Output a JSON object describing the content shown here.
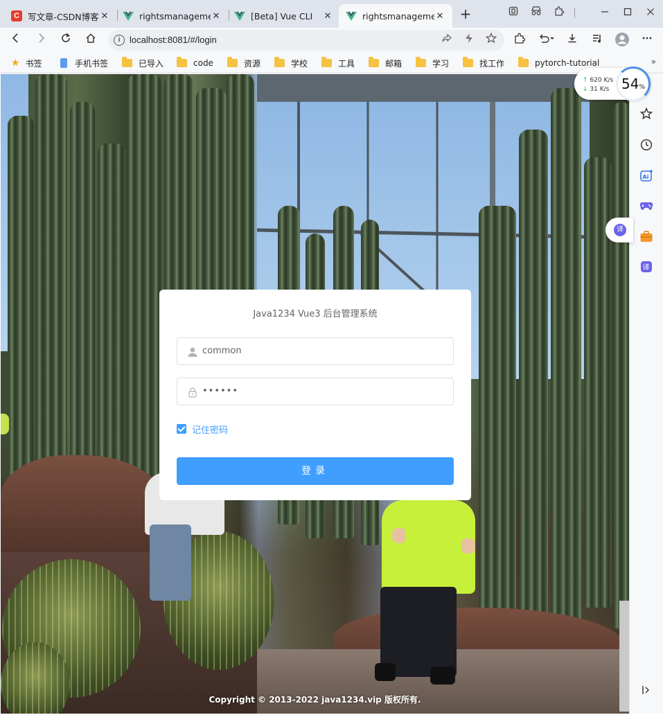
{
  "browser": {
    "tabs": [
      {
        "title": "写文章-CSDN博客",
        "close": "✕"
      },
      {
        "title": "rightsmanagemen",
        "close": "✕"
      },
      {
        "title": "[Beta] Vue CLI",
        "close": "✕"
      },
      {
        "title": "rightsmanagemen",
        "close": "✕"
      }
    ],
    "new_tab": "+",
    "csdn_letter": "C",
    "url": "localhost:8081/#/login",
    "info_glyph": "i",
    "bookmarks": [
      {
        "label": "书签",
        "icon": "star-icon"
      },
      {
        "label": "手机书签",
        "icon": "phone-icon"
      },
      {
        "label": "已导入",
        "icon": "folder-icon"
      },
      {
        "label": "code",
        "icon": "folder-icon"
      },
      {
        "label": "资源",
        "icon": "folder-icon"
      },
      {
        "label": "学校",
        "icon": "folder-icon"
      },
      {
        "label": "工具",
        "icon": "folder-icon"
      },
      {
        "label": "邮箱",
        "icon": "folder-icon"
      },
      {
        "label": "学习",
        "icon": "folder-icon"
      },
      {
        "label": "找工作",
        "icon": "folder-icon"
      },
      {
        "label": "pytorch-tutorial",
        "icon": "folder-icon"
      }
    ],
    "bookmarks_more": "»",
    "speed": {
      "up": "620 K/s",
      "down": "31 K/s",
      "percent": "54",
      "percent_sign": "%"
    },
    "translate_glyph": "译"
  },
  "login": {
    "title": "Java1234 Vue3 后台管理系统",
    "username": "common",
    "password_mask": "••••••",
    "remember_label": "记住密码",
    "remember_checked": true,
    "submit_label": "登录",
    "accent_color": "#409eff"
  },
  "footer": {
    "copyright": "Copyright © 2013-2022 java1234.vip 版权所有."
  }
}
